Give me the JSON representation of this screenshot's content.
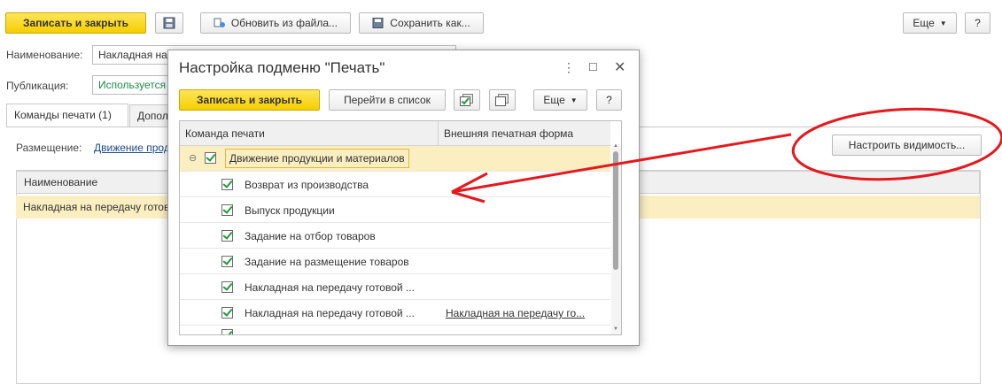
{
  "toolbar": {
    "save_close": "Записать и закрыть",
    "update_from_file": "Обновить из файла...",
    "save_as": "Сохранить как...",
    "more": "Еще",
    "help": "?"
  },
  "form": {
    "name_label": "Наименование:",
    "name_value": "Накладная на передачу готовой продукции",
    "publication_label": "Публикация:",
    "publication_value": "Используется",
    "tabs": [
      "Команды печати (1)",
      "Дополнительно"
    ],
    "placement_label": "Размещение:",
    "placement_value": "Движение продукции и материалов",
    "table": {
      "header": "Наименование",
      "row": "Накладная на передачу готовой продукции"
    },
    "configure_visibility": "Настроить видимость..."
  },
  "dialog": {
    "title": "Настройка подменю \"Печать\"",
    "save_close": "Записать и закрыть",
    "go_to_list": "Перейти в список",
    "more": "Еще",
    "help": "?",
    "columns": [
      "Команда печати",
      "Внешняя печатная форма"
    ],
    "group": "Движение продукции и материалов",
    "rows": [
      {
        "name": "Возврат из производства",
        "external": ""
      },
      {
        "name": "Выпуск продукции",
        "external": ""
      },
      {
        "name": "Задание на отбор товаров",
        "external": ""
      },
      {
        "name": "Задание на размещение товаров",
        "external": ""
      },
      {
        "name": "Накладная на передачу готовой ...",
        "external": ""
      },
      {
        "name": "Накладная на передачу готовой ...",
        "external": "Накладная на передачу го..."
      }
    ]
  },
  "annotation": {
    "color": "#e3191e"
  }
}
